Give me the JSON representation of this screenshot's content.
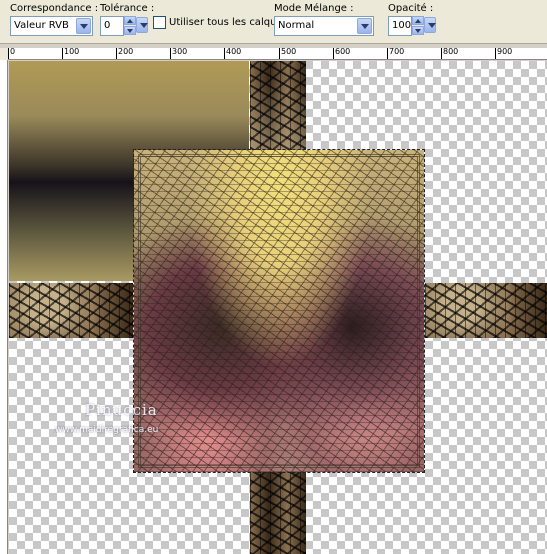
{
  "toolbar": {
    "match_mode": {
      "label": "Correspondance :",
      "value": "Valeur RVB"
    },
    "tolerance": {
      "label": "Tolérance :",
      "value": "0"
    },
    "use_all_layers": {
      "label": "Utiliser tous les calques",
      "checked": false
    },
    "blend_mode": {
      "label": "Mode Mélange :",
      "value": "Normal"
    },
    "opacity": {
      "label": "Opacité :",
      "value": "100"
    }
  },
  "ruler": {
    "top_labels": [
      "0",
      "100",
      "200",
      "300",
      "400",
      "500",
      "600",
      "700",
      "800",
      "900"
    ]
  },
  "canvas": {
    "watermark_name": "Pinuccia",
    "watermark_url": "www.maidiregrafica.eu"
  },
  "icons": [
    "dropdown-arrow-icon",
    "spin-up-icon",
    "spin-down-icon"
  ]
}
